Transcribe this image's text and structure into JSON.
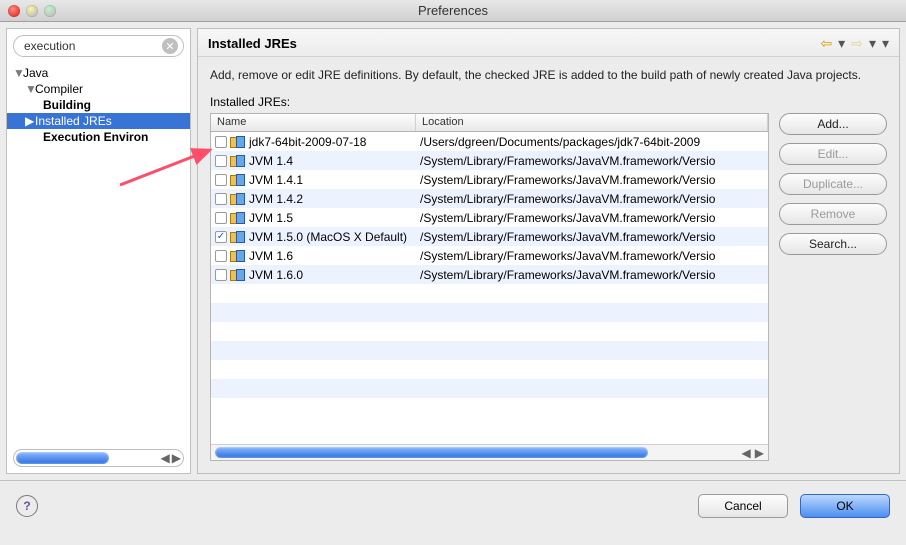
{
  "window": {
    "title": "Preferences"
  },
  "sidebar": {
    "search_value": "execution",
    "nodes": {
      "java": "Java",
      "compiler": "Compiler",
      "building": "Building",
      "installed_jres": "Installed JREs",
      "exec_env": "Execution Environ"
    }
  },
  "main": {
    "title": "Installed JREs",
    "description": "Add, remove or edit JRE definitions. By default, the checked JRE is added to the build path of newly created Java projects.",
    "list_label": "Installed JREs:",
    "columns": {
      "name": "Name",
      "location": "Location"
    },
    "rows": [
      {
        "checked": false,
        "name": "jdk7-64bit-2009-07-18",
        "location": "/Users/dgreen/Documents/packages/jdk7-64bit-2009"
      },
      {
        "checked": false,
        "name": "JVM 1.4",
        "location": "/System/Library/Frameworks/JavaVM.framework/Versio"
      },
      {
        "checked": false,
        "name": "JVM 1.4.1",
        "location": "/System/Library/Frameworks/JavaVM.framework/Versio"
      },
      {
        "checked": false,
        "name": "JVM 1.4.2",
        "location": "/System/Library/Frameworks/JavaVM.framework/Versio"
      },
      {
        "checked": false,
        "name": "JVM 1.5",
        "location": "/System/Library/Frameworks/JavaVM.framework/Versio"
      },
      {
        "checked": true,
        "name": "JVM 1.5.0 (MacOS X Default)",
        "location": "/System/Library/Frameworks/JavaVM.framework/Versio"
      },
      {
        "checked": false,
        "name": "JVM 1.6",
        "location": "/System/Library/Frameworks/JavaVM.framework/Versio"
      },
      {
        "checked": false,
        "name": "JVM 1.6.0",
        "location": "/System/Library/Frameworks/JavaVM.framework/Versio"
      }
    ],
    "buttons": {
      "add": "Add...",
      "edit": "Edit...",
      "duplicate": "Duplicate...",
      "remove": "Remove",
      "search": "Search..."
    }
  },
  "footer": {
    "cancel": "Cancel",
    "ok": "OK"
  }
}
